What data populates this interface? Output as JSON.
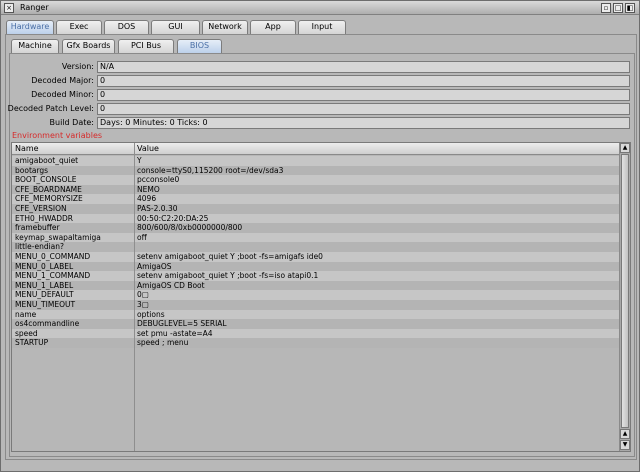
{
  "window": {
    "title": "Ranger",
    "icons": {
      "close": "close-icon",
      "depth": "depth-icon",
      "zoom": "zoom-icon",
      "minimize": "minimize-icon"
    }
  },
  "main_tabs": [
    {
      "label": "Hardware",
      "active": true
    },
    {
      "label": "Exec",
      "active": false
    },
    {
      "label": "DOS",
      "active": false
    },
    {
      "label": "GUI",
      "active": false
    },
    {
      "label": "Network",
      "active": false
    },
    {
      "label": "App",
      "active": false
    },
    {
      "label": "Input",
      "active": false
    }
  ],
  "sub_tabs": [
    {
      "label": "Machine",
      "active": false
    },
    {
      "label": "Gfx Boards",
      "active": false
    },
    {
      "label": "PCI Bus",
      "active": false
    },
    {
      "label": "BIOS",
      "active": true
    }
  ],
  "fields": [
    {
      "label": "Version:",
      "value": "N/A"
    },
    {
      "label": "Decoded Major:",
      "value": "0"
    },
    {
      "label": "Decoded Minor:",
      "value": "0"
    },
    {
      "label": "Decoded Patch Level:",
      "value": "0"
    },
    {
      "label": "Build Date:",
      "value": "Days: 0 Minutes: 0 Ticks: 0"
    }
  ],
  "env": {
    "section_label": "Environment variables",
    "columns": [
      "Name",
      "Value"
    ],
    "rows": [
      {
        "name": "amigaboot_quiet",
        "value": "Y"
      },
      {
        "name": "bootargs",
        "value": "console=ttyS0,115200 root=/dev/sda3"
      },
      {
        "name": "BOOT_CONSOLE",
        "value": "pcconsole0"
      },
      {
        "name": "CFE_BOARDNAME",
        "value": "NEMO"
      },
      {
        "name": "CFE_MEMORYSIZE",
        "value": "4096"
      },
      {
        "name": "CFE_VERSION",
        "value": "PAS-2.0.30"
      },
      {
        "name": "ETH0_HWADDR",
        "value": "00:50:C2:20:DA:25"
      },
      {
        "name": "framebuffer",
        "value": "800/600/8/0xb0000000/800"
      },
      {
        "name": "keymap_swapaltamiga",
        "value": "off"
      },
      {
        "name": "little-endian?",
        "value": ""
      },
      {
        "name": "MENU_0_COMMAND",
        "value": "setenv amigaboot_quiet Y ;boot -fs=amigafs ide0"
      },
      {
        "name": "MENU_0_LABEL",
        "value": "AmigaOS"
      },
      {
        "name": "MENU_1_COMMAND",
        "value": "setenv amigaboot_quiet Y ;boot -fs=iso atapi0.1"
      },
      {
        "name": "MENU_1_LABEL",
        "value": "AmigaOS CD Boot"
      },
      {
        "name": "MENU_DEFAULT",
        "value": "0▢"
      },
      {
        "name": "MENU_TIMEOUT",
        "value": "3▢"
      },
      {
        "name": "name",
        "value": "options"
      },
      {
        "name": "os4commandline",
        "value": "DEBUGLEVEL=5 SERIAL"
      },
      {
        "name": "speed",
        "value": "set pmu -astate=A4"
      },
      {
        "name": "STARTUP",
        "value": "speed ; menu"
      }
    ]
  }
}
